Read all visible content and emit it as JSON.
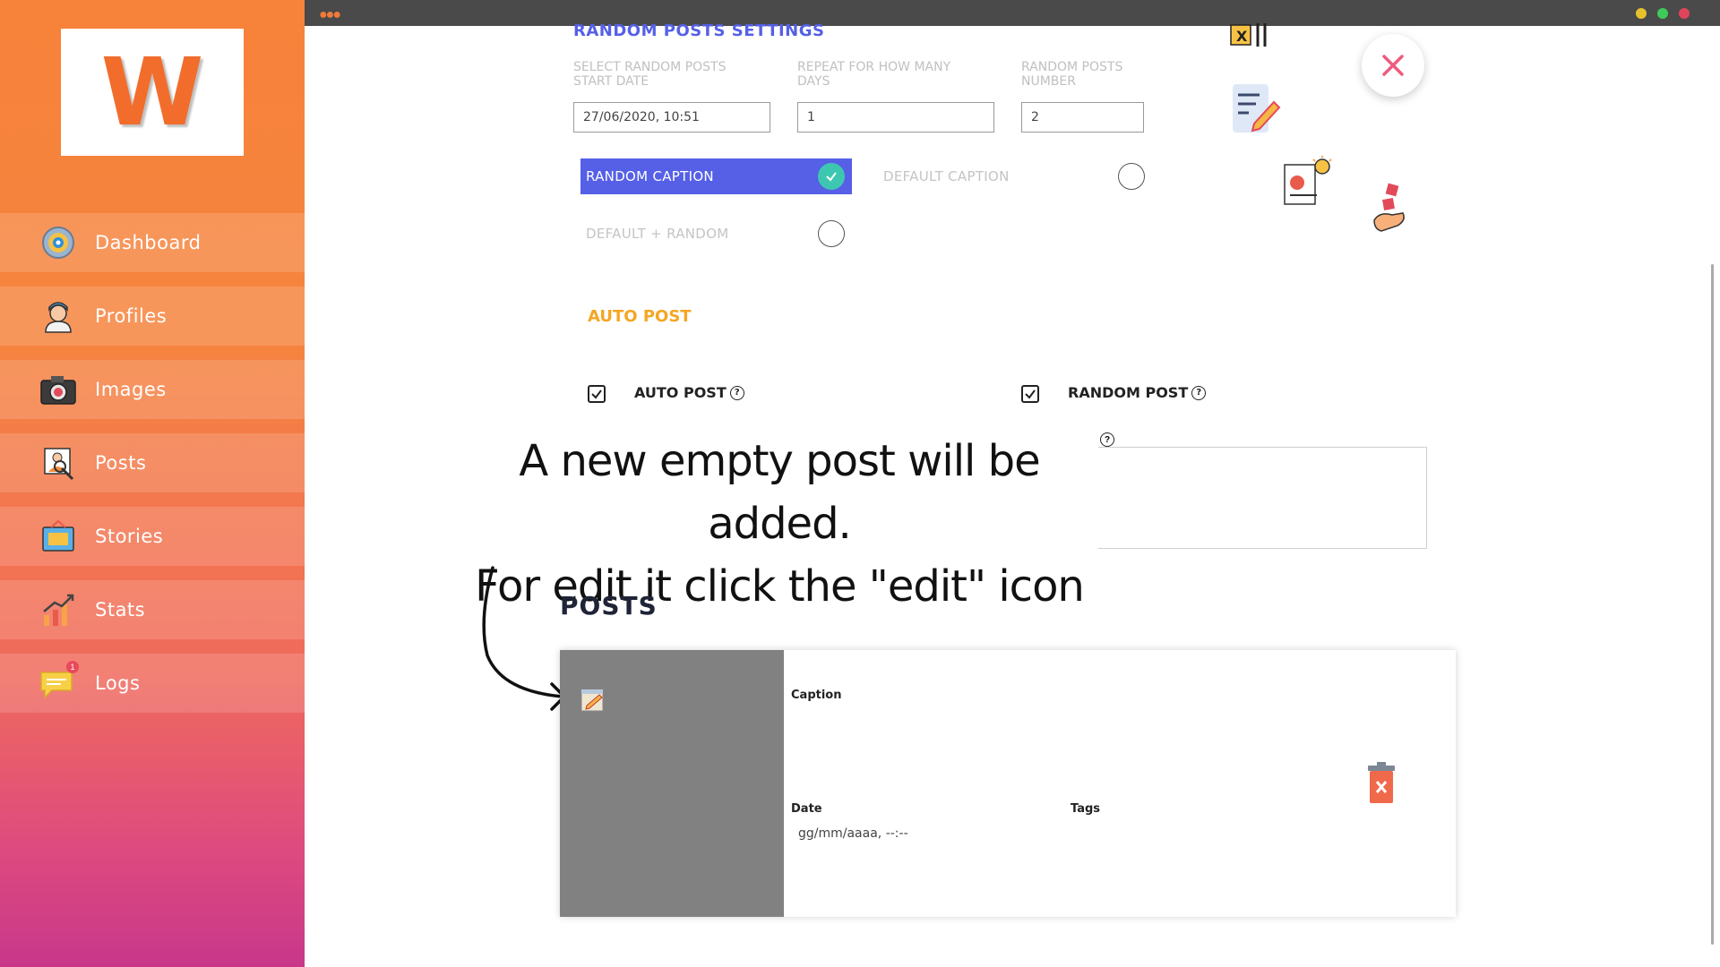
{
  "sidebar": {
    "logo_letter": "W",
    "items": [
      {
        "label": "Dashboard",
        "icon": "dashboard-gauge-icon"
      },
      {
        "label": "Profiles",
        "icon": "profile-avatar-icon"
      },
      {
        "label": "Images",
        "icon": "camera-icon"
      },
      {
        "label": "Posts",
        "icon": "posts-picture-icon"
      },
      {
        "label": "Stories",
        "icon": "stories-icon"
      },
      {
        "label": "Stats",
        "icon": "stats-chart-icon"
      },
      {
        "label": "Logs",
        "icon": "logs-message-icon"
      }
    ],
    "logs_badge": "1"
  },
  "window": {
    "controls": [
      "#e8c12f",
      "#3fc95a",
      "#e0445a"
    ]
  },
  "random_settings": {
    "title": "RANDOM POSTS SETTINGS",
    "start_date_label": "SELECT RANDOM POSTS START DATE",
    "start_date_value": "27/06/2020, 10:51",
    "repeat_label": "REPEAT FOR HOW MANY DAYS",
    "repeat_value": "1",
    "number_label": "RANDOM POSTS NUMBER",
    "number_value": "2",
    "options": {
      "random_caption": "RANDOM CAPTION",
      "default_caption": "DEFAULT CAPTION",
      "default_random": "DEFAULT + RANDOM"
    },
    "selected_option": "random_caption"
  },
  "auto_post": {
    "title": "AUTO POST",
    "auto_post_label": "AUTO POST",
    "random_post_label": "RANDOM POST",
    "auto_post_checked": true,
    "random_post_checked": true,
    "help_glyph": "?"
  },
  "annotation": {
    "line1": "A new empty post will be added.",
    "line2": "For edit it click the \"edit\" icon"
  },
  "posts": {
    "title": "POSTS",
    "card": {
      "caption_label": "Caption",
      "date_label": "Date",
      "date_placeholder": "gg/mm/aaaa, --:--",
      "tags_label": "Tags"
    }
  },
  "colors": {
    "accent_blue": "#5560e6",
    "auto_post_orange": "#f5a623",
    "check_teal": "#3ec7b0",
    "delete_red": "#f0694a",
    "close_pink": "#f05a7e"
  }
}
